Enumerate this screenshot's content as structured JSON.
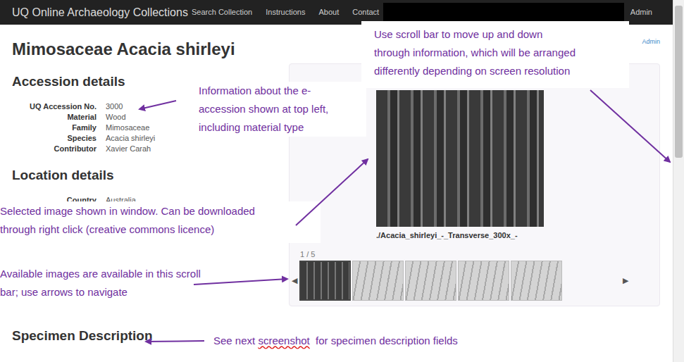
{
  "nav": {
    "brand": "UQ Online Archaeology Collections",
    "links": [
      {
        "label": "Search Collection"
      },
      {
        "label": "Instructions"
      },
      {
        "label": "About"
      },
      {
        "label": "Contact"
      }
    ],
    "admin": "Admin"
  },
  "page": {
    "title": "Mimosaceae Acacia shirleyi",
    "admin_link": "Admin"
  },
  "accession": {
    "heading": "Accession details",
    "fields": [
      {
        "label": "UQ Accession No.",
        "value": "3000"
      },
      {
        "label": "Material",
        "value": "Wood"
      },
      {
        "label": "Family",
        "value": "Mimosaceae"
      },
      {
        "label": "Species",
        "value": "Acacia shirleyi"
      },
      {
        "label": "Contributor",
        "value": "Xavier Carah"
      }
    ]
  },
  "location": {
    "heading": "Location details",
    "fields": [
      {
        "label": "Country",
        "value": "Australia"
      }
    ]
  },
  "gallery": {
    "caption": "./Acacia_shirleyi_-_Transverse_300x_-",
    "counter": "1 / 5",
    "prev": "◀",
    "next": "▶",
    "thumbnails": [
      {
        "selected": true
      },
      {
        "selected": false
      },
      {
        "selected": false
      },
      {
        "selected": false
      },
      {
        "selected": false
      }
    ]
  },
  "specimen": {
    "heading": "Specimen Description"
  },
  "annotations": [
    {
      "lines": [
        "Information about the e-",
        "accession shown at top left,",
        "including material type"
      ]
    },
    {
      "lines": [
        "Use scroll bar to move up and down",
        "through information, which will be arranged",
        "differently depending on screen resolution"
      ]
    },
    {
      "lines": [
        "Selected image shown in window. Can be downloaded",
        "through right click (creative commons licence)"
      ]
    },
    {
      "lines": [
        "Available images are available in this scroll",
        "bar; use arrows to navigate"
      ]
    }
  ],
  "footer_note": {
    "parts": [
      {
        "text": "See next ",
        "misspelled": false
      },
      {
        "text": "screenshot",
        "misspelled": true
      },
      {
        "text": "  for specimen description fields",
        "misspelled": false
      }
    ]
  },
  "scrollbar": {
    "level": 0.42
  }
}
